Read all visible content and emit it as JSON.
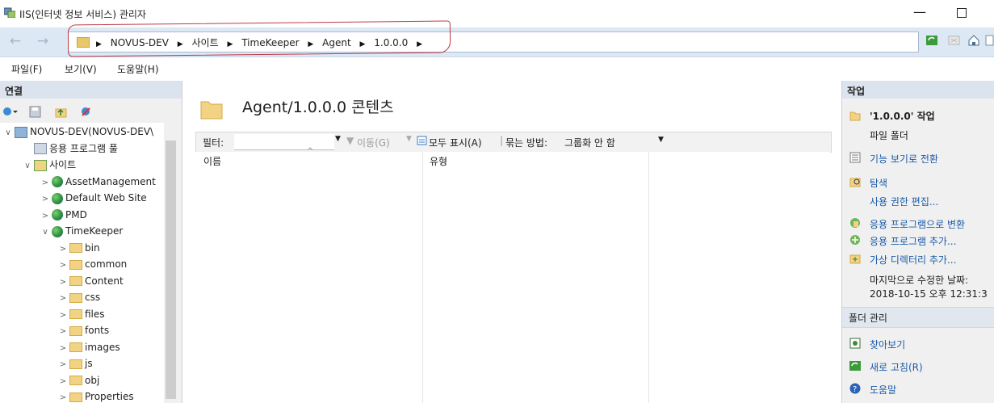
{
  "window": {
    "title": "IIS(인터넷 정보 서비스) 관리자",
    "minimize": "—"
  },
  "address": {
    "back": "←",
    "forward": "→",
    "crumbs": [
      "NOVUS-DEV",
      "사이트",
      "TimeKeeper",
      "Agent",
      "1.0.0.0"
    ]
  },
  "menu": [
    "파일(F)",
    "보기(V)",
    "도움말(H)"
  ],
  "connections": {
    "header": "연결",
    "tree": [
      {
        "label": "NOVUS-DEV(NOVUS-DEV\\",
        "expander": "∨"
      },
      {
        "label": "응용 프로그램 풀",
        "expander": ""
      },
      {
        "label": "사이트",
        "expander": "∨"
      },
      {
        "label": "AssetManagement",
        "expander": ">"
      },
      {
        "label": "Default Web Site",
        "expander": ">"
      },
      {
        "label": "PMD",
        "expander": ">"
      },
      {
        "label": "TimeKeeper",
        "expander": "∨"
      },
      {
        "label": "bin",
        "expander": ">"
      },
      {
        "label": "common",
        "expander": ">"
      },
      {
        "label": "Content",
        "expander": ">"
      },
      {
        "label": "css",
        "expander": ">"
      },
      {
        "label": "files",
        "expander": ">"
      },
      {
        "label": "fonts",
        "expander": ">"
      },
      {
        "label": "images",
        "expander": ">"
      },
      {
        "label": "js",
        "expander": ">"
      },
      {
        "label": "obj",
        "expander": ">"
      },
      {
        "label": "Properties",
        "expander": ">"
      }
    ]
  },
  "content": {
    "title": "Agent/1.0.0.0 콘텐츠",
    "filter_label": "필터:",
    "filter_value": "",
    "go_label": "이동(G)",
    "showall_label": "모두 표시(A)",
    "groupby_label": "묶는 방법:",
    "groupby_value": "그룹화 안 함",
    "columns": [
      "이름",
      "유형"
    ]
  },
  "actions": {
    "header": "작업",
    "item_title": "'1.0.0.0' 작업",
    "item_subtitle": "파일 폴더",
    "switch_view": "기능 보기로 전환",
    "explore": "탐색",
    "edit_permissions": "사용 권한 편집...",
    "convert_app": "응용 프로그램으로 변환",
    "add_app": "응용 프로그램 추가...",
    "add_vdir": "가상 디렉터리 추가...",
    "last_modified_label": "마지막으로 수정한 날짜:",
    "last_modified_value": "2018-10-15 오후 12:31:3",
    "folder_mgmt": "폴더 관리",
    "browse": "찾아보기",
    "refresh": "새로 고침(R)",
    "help": "도움말"
  }
}
